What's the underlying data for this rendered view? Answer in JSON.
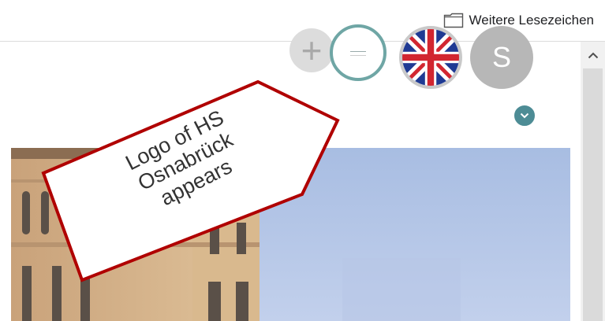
{
  "bookmarks_bar": {
    "folder_label": "Weitere Lesezeichen",
    "folder_icon": "folder-icon"
  },
  "header": {
    "add_icon": "plus-icon",
    "logo_icon": "hs-osnabrueck-logo-icon",
    "language_icon": "uk-flag-icon",
    "avatar_initial": "S",
    "avatar_badge_icon": "chevron-down-icon"
  },
  "scrollbar": {
    "up_icon": "chevron-up-icon"
  },
  "annotation": {
    "lines": [
      "Logo of HS",
      "Osnabrück",
      "appears"
    ],
    "border_color": "#b00000"
  },
  "colors": {
    "accent_teal": "#6fa6a5",
    "badge_teal": "#4d8c95",
    "avatar_gray": "#b7b7b7"
  }
}
